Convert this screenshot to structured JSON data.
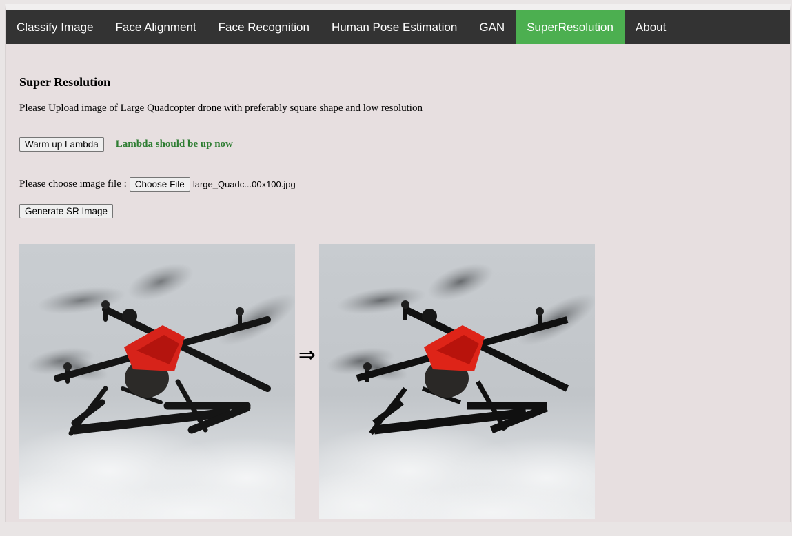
{
  "nav": {
    "items": [
      {
        "label": "Classify Image",
        "active": false
      },
      {
        "label": "Face Alignment",
        "active": false
      },
      {
        "label": "Face Recognition",
        "active": false
      },
      {
        "label": "Human Pose Estimation",
        "active": false
      },
      {
        "label": "GAN",
        "active": false
      },
      {
        "label": "SuperResolution",
        "active": true
      },
      {
        "label": "About",
        "active": false
      }
    ],
    "active_color": "#4caf50",
    "bar_color": "#333333"
  },
  "page": {
    "title": "Super Resolution",
    "description": "Please Upload image of Large Quadcopter drone with preferably square shape and low resolution"
  },
  "warmup": {
    "button_label": "Warm up Lambda",
    "status_text": "Lambda should be up now",
    "status_color": "#2e7d32"
  },
  "file": {
    "label": "Please choose image file :",
    "button_label": "Choose File",
    "file_name": "large_Quadc...00x100.jpg"
  },
  "generate": {
    "button_label": "Generate SR Image"
  },
  "result": {
    "arrow_glyph": "⇒",
    "input_image_icon": "quadcopter-drone-image",
    "output_image_icon": "quadcopter-drone-image"
  }
}
